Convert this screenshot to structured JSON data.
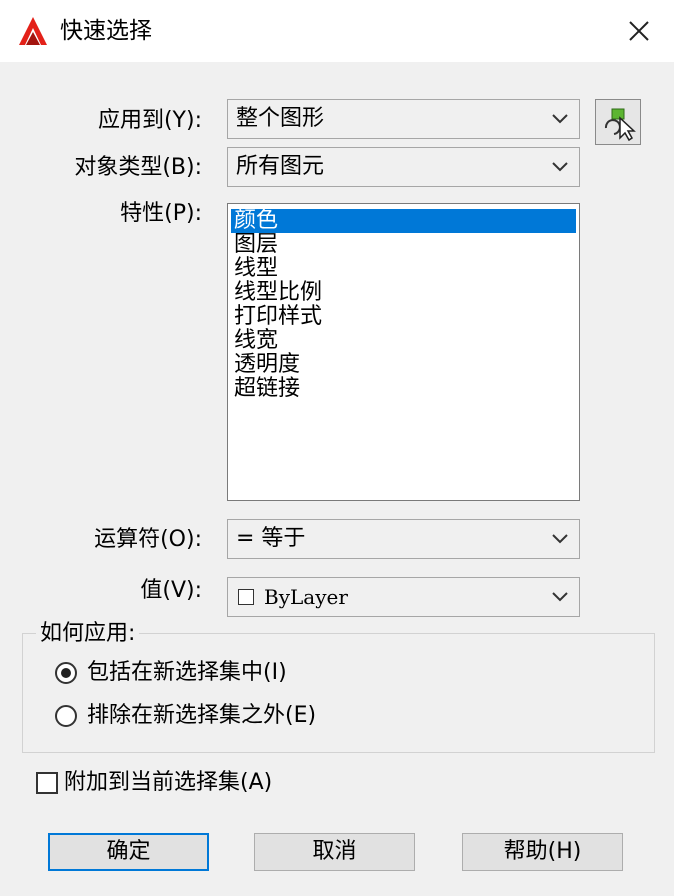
{
  "window": {
    "title": "快速选择",
    "icon": "autocad-logo-icon",
    "close_icon": "close-icon"
  },
  "apply_to": {
    "label": "应用到(Y):",
    "value": "整个图形"
  },
  "object_type": {
    "label": "对象类型(B):",
    "value": "所有图元"
  },
  "properties": {
    "label": "特性(P):",
    "items": [
      "颜色",
      "图层",
      "线型",
      "线型比例",
      "打印样式",
      "线宽",
      "透明度",
      "超链接"
    ],
    "selected_index": 0
  },
  "operator": {
    "label": "运算符(O):",
    "value": "= 等于"
  },
  "value": {
    "label": "值(V):",
    "value": "ByLayer"
  },
  "how_to_apply": {
    "title": "如何应用:",
    "include_label": "包括在新选择集中(I)",
    "exclude_label": "排除在新选择集之外(E)",
    "selected": "include"
  },
  "append": {
    "label": "附加到当前选择集(A)",
    "checked": false
  },
  "buttons": {
    "ok": "确定",
    "cancel": "取消",
    "help": "帮助(H)"
  },
  "colors": {
    "selection": "#0078d7",
    "default_button_border": "#0078d7"
  }
}
